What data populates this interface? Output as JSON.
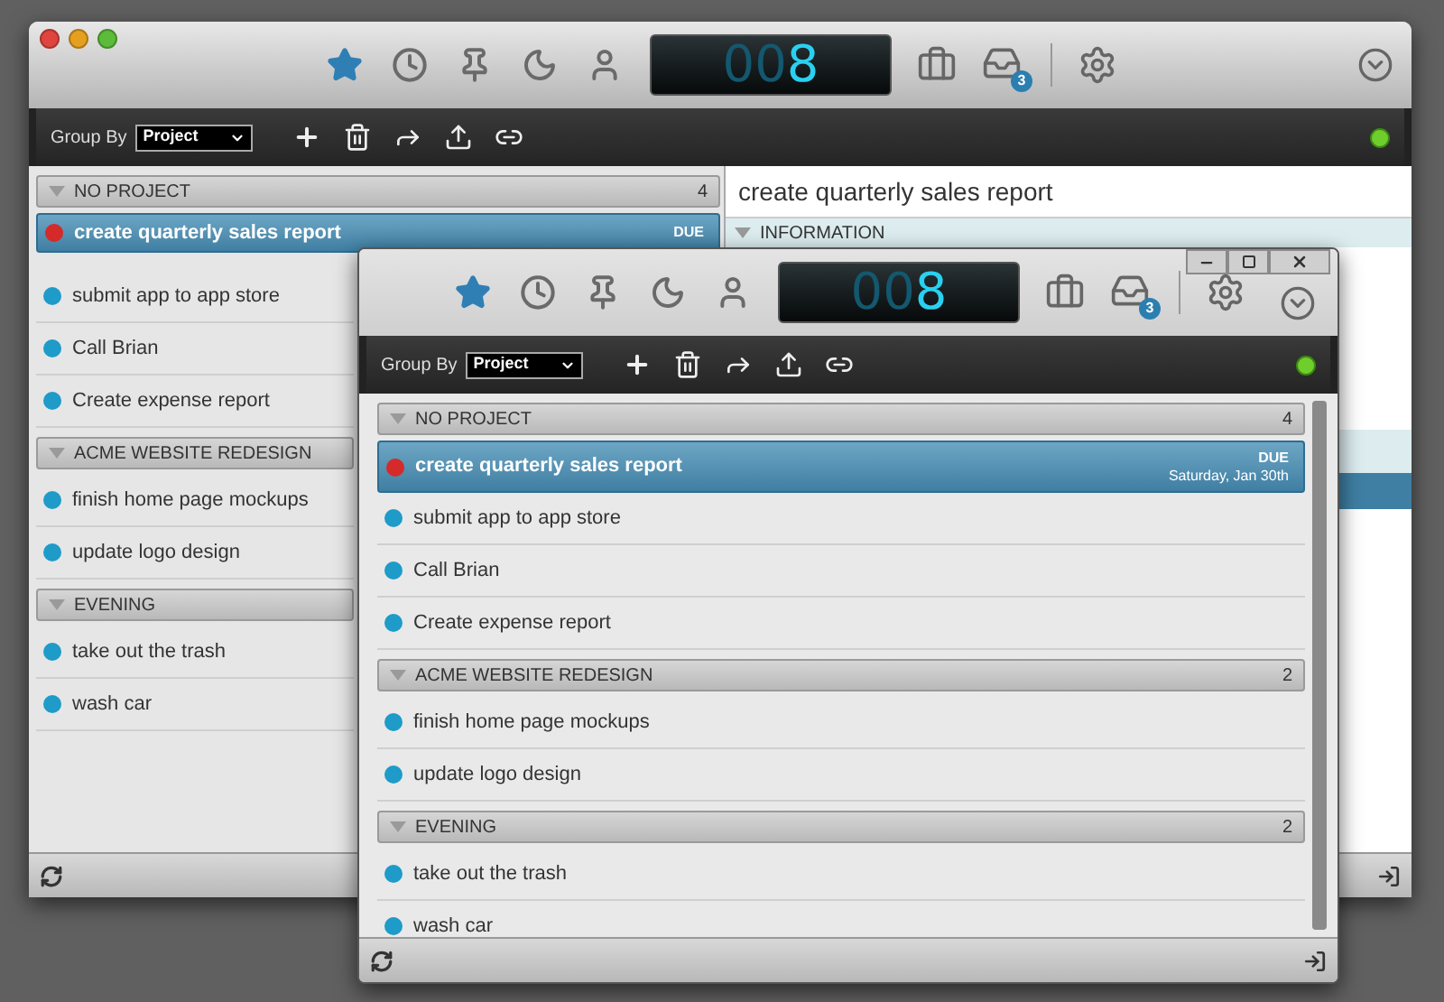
{
  "windows": [
    {
      "kind": "mac",
      "view_buttons": [
        {
          "selected": true
        },
        {
          "selected": false
        },
        {
          "selected": false
        },
        {
          "selected": false
        },
        {
          "selected": false
        }
      ],
      "counter": {
        "dim": "00",
        "lit": "8"
      },
      "inbox_badge": "3",
      "group_by": {
        "label": "Group By",
        "value": "Project"
      },
      "connected": true,
      "groups": [
        {
          "name": "NO PROJECT",
          "count": "4",
          "expanded": true,
          "tasks": [
            {
              "title": "create quarterly sales report",
              "selected": true,
              "color": "#d42a2a",
              "due_label": "DUE"
            },
            {
              "title": "submit app to app store",
              "selected": false,
              "color": "#1e9bc8"
            },
            {
              "title": "Call Brian",
              "selected": false,
              "color": "#1e9bc8"
            },
            {
              "title": "Create expense report",
              "selected": false,
              "color": "#1e9bc8"
            }
          ]
        },
        {
          "name": "ACME WEBSITE REDESIGN",
          "expanded": true,
          "tasks": [
            {
              "title": "finish home page mockups",
              "selected": false,
              "color": "#1e9bc8"
            },
            {
              "title": "update logo design",
              "selected": false,
              "color": "#1e9bc8"
            }
          ]
        },
        {
          "name": "EVENING",
          "expanded": true,
          "tasks": [
            {
              "title": "take out the trash",
              "selected": false,
              "color": "#1e9bc8"
            },
            {
              "title": "wash car",
              "selected": false,
              "color": "#1e9bc8"
            }
          ]
        }
      ],
      "detail": {
        "title": "create quarterly sales report",
        "section": "INFORMATION"
      }
    },
    {
      "kind": "windows",
      "view_buttons": [
        {
          "selected": true
        },
        {
          "selected": false
        },
        {
          "selected": false
        },
        {
          "selected": false
        },
        {
          "selected": false
        }
      ],
      "counter": {
        "dim": "00",
        "lit": "8"
      },
      "inbox_badge": "3",
      "group_by": {
        "label": "Group By",
        "value": "Project"
      },
      "connected": true,
      "groups": [
        {
          "name": "NO PROJECT",
          "count": "4",
          "expanded": true,
          "tasks": [
            {
              "title": "create quarterly sales report",
              "selected": true,
              "color": "#d42a2a",
              "due_label": "DUE",
              "due_date": "Saturday, Jan 30th"
            },
            {
              "title": "submit app to app store",
              "selected": false,
              "color": "#1e9bc8"
            },
            {
              "title": "Call Brian",
              "selected": false,
              "color": "#1e9bc8"
            },
            {
              "title": "Create expense report",
              "selected": false,
              "color": "#1e9bc8"
            }
          ]
        },
        {
          "name": "ACME WEBSITE REDESIGN",
          "count": "2",
          "expanded": true,
          "tasks": [
            {
              "title": "finish home page mockups",
              "selected": false,
              "color": "#1e9bc8"
            },
            {
              "title": "update logo design",
              "selected": false,
              "color": "#1e9bc8"
            }
          ]
        },
        {
          "name": "EVENING",
          "count": "2",
          "expanded": true,
          "tasks": [
            {
              "title": "take out the trash",
              "selected": false,
              "color": "#1e9bc8"
            },
            {
              "title": "wash car",
              "selected": false,
              "color": "#1e9bc8"
            }
          ]
        }
      ]
    }
  ]
}
